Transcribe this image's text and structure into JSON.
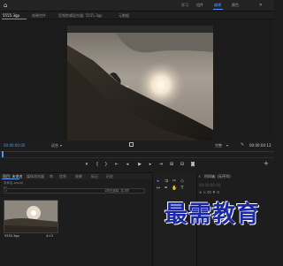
{
  "top_bar": {
    "workspace_tabs": [
      "学习",
      "组件",
      "编辑",
      "颜色"
    ]
  },
  "source_tabs": {
    "tabs": [
      "源(无剪辑)",
      "效果控件",
      "音频剪辑混合器: 5555.3gp",
      "元数据"
    ],
    "active_index": 0,
    "active_label": "5555.3gp"
  },
  "program_monitor": {
    "timecode_current": "00:00:00:00",
    "fit_label": "适合",
    "resolution_label": "完整",
    "timecode_duration": "00:00:04:13"
  },
  "project_panel": {
    "tabs": [
      "项目: 未命名",
      "媒体浏览器",
      "库",
      "信息",
      "效果",
      "标记",
      "历史"
    ],
    "path": "未命名.prproj",
    "item_count": "1项已选择, 共1项",
    "clip": {
      "name": "5555.3gp",
      "duration": "4:13"
    }
  },
  "timeline_panel": {
    "title": "时间轴: (无序列)",
    "timecode": "00:00:00:00"
  },
  "watermark": "最需教育",
  "icons": {
    "home": "home-icon",
    "more": "more-icon",
    "wrench": "wrench-icon",
    "plus": "plus-icon",
    "search": "search-icon",
    "folder": "folder-icon"
  },
  "colors": {
    "accent": "#4d95ff",
    "watermark": "#1a27a8"
  }
}
